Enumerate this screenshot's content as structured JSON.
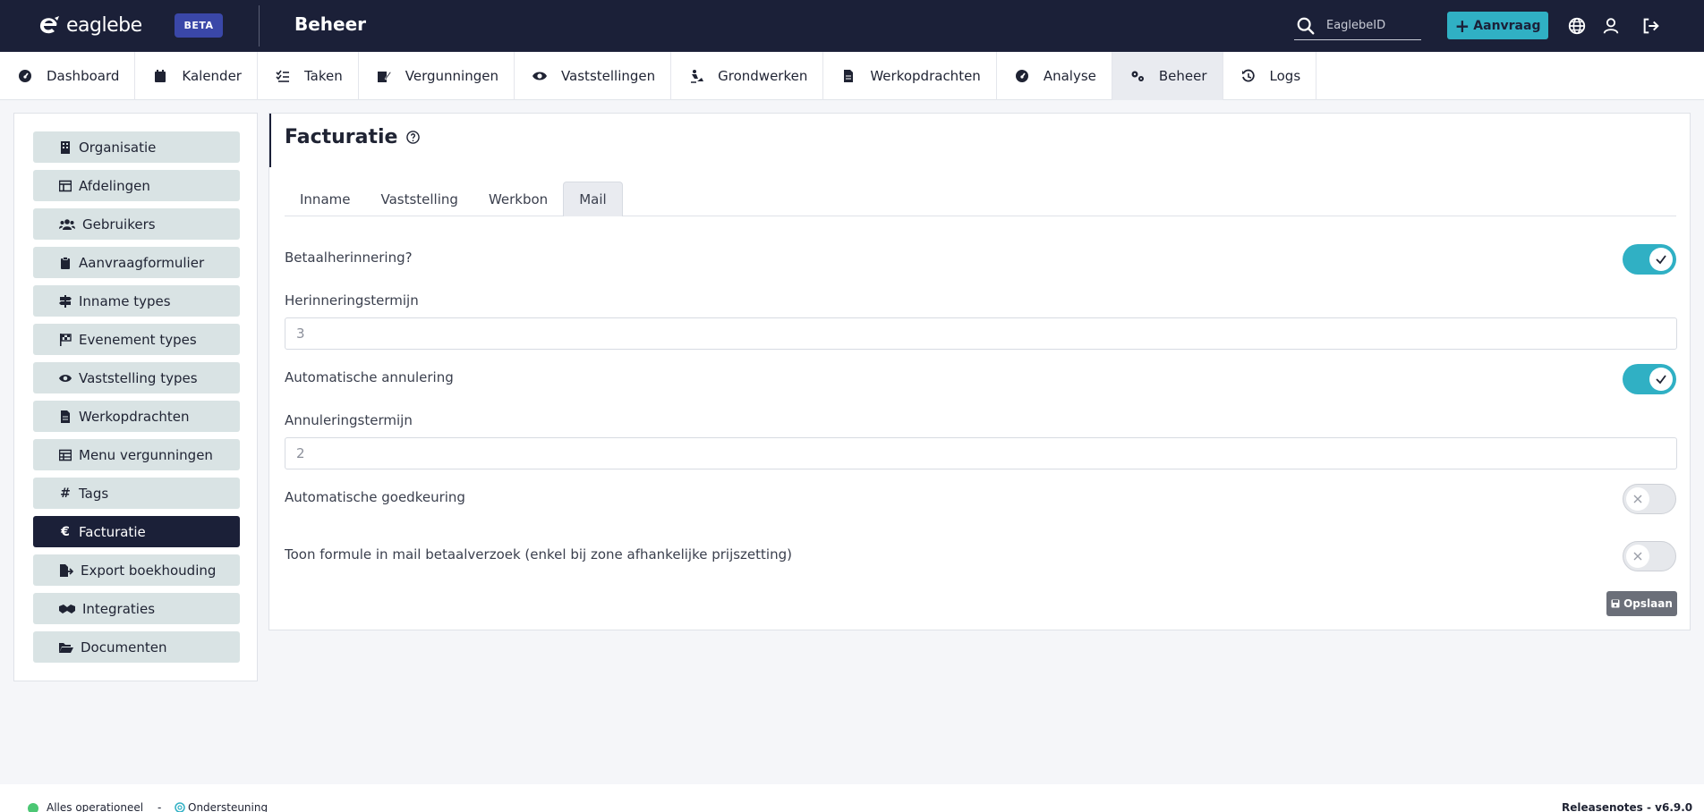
{
  "header": {
    "logo_text": "eaglebe",
    "beta_label": "BETA",
    "app_title": "Beheer",
    "search_placeholder": "EaglebeID",
    "aanvraag_label": "Aanvraag"
  },
  "nav": {
    "items": [
      {
        "label": "Dashboard",
        "icon": "dashboard-icon"
      },
      {
        "label": "Kalender",
        "icon": "calendar-icon"
      },
      {
        "label": "Taken",
        "icon": "tasks-icon"
      },
      {
        "label": "Vergunningen",
        "icon": "permit-icon"
      },
      {
        "label": "Vaststellingen",
        "icon": "eye-icon"
      },
      {
        "label": "Grondwerken",
        "icon": "digging-icon"
      },
      {
        "label": "Werkopdrachten",
        "icon": "file-icon"
      },
      {
        "label": "Analyse",
        "icon": "gauge-icon"
      },
      {
        "label": "Beheer",
        "icon": "gears-icon"
      },
      {
        "label": "Logs",
        "icon": "history-icon"
      }
    ],
    "active": "Beheer"
  },
  "sidebar": {
    "items": [
      {
        "label": "Organisatie",
        "icon": "building-icon"
      },
      {
        "label": "Afdelingen",
        "icon": "table-icon"
      },
      {
        "label": "Gebruikers",
        "icon": "users-icon"
      },
      {
        "label": "Aanvraagformulier",
        "icon": "clipboard-icon"
      },
      {
        "label": "Inname types",
        "icon": "signs-icon"
      },
      {
        "label": "Evenement types",
        "icon": "flag-icon"
      },
      {
        "label": "Vaststelling types",
        "icon": "eye-icon"
      },
      {
        "label": "Werkopdrachten",
        "icon": "file-icon"
      },
      {
        "label": "Menu vergunningen",
        "icon": "grid-icon"
      },
      {
        "label": "Tags",
        "icon": "hashtag-icon"
      },
      {
        "label": "Facturatie",
        "icon": "euro-icon"
      },
      {
        "label": "Export boekhouding",
        "icon": "file-export-icon"
      },
      {
        "label": "Integraties",
        "icon": "handshake-icon"
      },
      {
        "label": "Documenten",
        "icon": "folder-open-icon"
      }
    ],
    "active": "Facturatie",
    "hash_glyph": "#",
    "euro_glyph": "€"
  },
  "main": {
    "title": "Facturatie",
    "tabs": [
      "Inname",
      "Vaststelling",
      "Werkbon",
      "Mail"
    ],
    "active_tab": "Mail",
    "fields": {
      "betaalherinnering_label": "Betaalherinnering?",
      "betaalherinnering_on": true,
      "herinneringstermijn_label": "Herinneringstermijn",
      "herinneringstermijn_value": "3",
      "automatische_annulering_label": "Automatische annulering",
      "automatische_annulering_on": true,
      "annuleringstermijn_label": "Annuleringstermijn",
      "annuleringstermijn_value": "2",
      "automatische_goedkeuring_label": "Automatische goedkeuring",
      "automatische_goedkeuring_on": false,
      "toon_formule_label": "Toon formule in mail betaalverzoek (enkel bij zone afhankelijke prijszetting)",
      "toon_formule_on": false
    },
    "save_label": "Opslaan"
  },
  "footer": {
    "status_text": "Alles operationeel",
    "separator": "-",
    "support_text": "Ondersteuning",
    "release_text": "Releasenotes - v6.9.0"
  },
  "colors": {
    "navy": "#1b2038",
    "teal": "#30b0c4",
    "sidebar_item": "#d9e3e4",
    "status_green": "#4cc774"
  }
}
